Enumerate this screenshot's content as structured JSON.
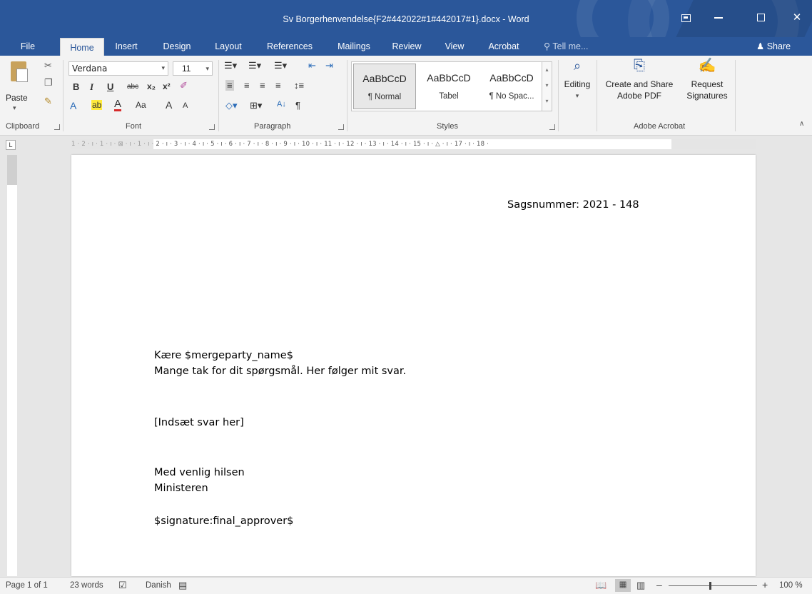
{
  "window": {
    "title": "Sv Borgerhenvendelse{F2#442022#1#442017#1}.docx  -  Word",
    "minimize": "–",
    "close": "✕"
  },
  "tabs": [
    "File",
    "Home",
    "Insert",
    "Design",
    "Layout",
    "References",
    "Mailings",
    "Review",
    "View",
    "Acrobat"
  ],
  "tell_me": "Tell me...",
  "share": "Share",
  "ribbon": {
    "clipboard": {
      "label": "Clipboard",
      "paste": "Paste"
    },
    "font": {
      "label": "Font",
      "family": "Verdana",
      "size": "11",
      "bold": "B",
      "italic": "I",
      "underline": "U",
      "strike": "abc",
      "subscript": "x₂",
      "superscript": "x²",
      "text_effects": "A",
      "highlight": "ab",
      "font_color": "A",
      "change_case": "Aa",
      "grow": "A",
      "shrink": "A"
    },
    "paragraph": {
      "label": "Paragraph",
      "sort": "A↓",
      "pilcrow": "¶"
    },
    "styles": {
      "label": "Styles",
      "items": [
        {
          "sample": "AaBbCcD",
          "name": "¶ Normal"
        },
        {
          "sample": "AaBbCcD",
          "name": "Tabel"
        },
        {
          "sample": "AaBbCcD",
          "name": "¶ No Spac..."
        }
      ]
    },
    "editing": {
      "label": "Editing"
    },
    "acrobat": {
      "label": "Adobe Acrobat",
      "create_share": "Create and Share\nAdobe PDF",
      "create_line1": "Create and Share",
      "create_line2": "Adobe PDF",
      "request_line1": "Request",
      "request_line2": "Signatures"
    }
  },
  "ruler": {
    "horizontal": "1 · 2 · ı · 1 · ı · ⊠ · ı · 1 · ı · 2 · ı · 3 · ı · 4 · ı · 5 · ı · 6 · ı · 7 · ı · 8 · ı · 9 · ı · 10 · ı · 11 · ı · 12 · ı · 13 · ı · 14 · ı · 15 · ı · △ · ı · 17 · ı · 18 ·",
    "corner": "L"
  },
  "document": {
    "case_number": "Sagsnummer: 2021 - 148",
    "greeting": "Kære $mergeparty_name$",
    "intro": "Mange tak for dit spørgsmål. Her følger mit svar.",
    "placeholder": "[Indsæt svar her]",
    "closing": "Med venlig hilsen",
    "sender": "Ministeren",
    "signature": "$signature:final_approver$"
  },
  "status": {
    "page": "Page 1 of 1",
    "words": "23 words",
    "language": "Danish",
    "zoom": "100 %",
    "zoom_minus": "–",
    "zoom_plus": "+"
  },
  "colors": {
    "word_blue": "#2b579a",
    "ribbon_bg": "#f3f3f3"
  }
}
